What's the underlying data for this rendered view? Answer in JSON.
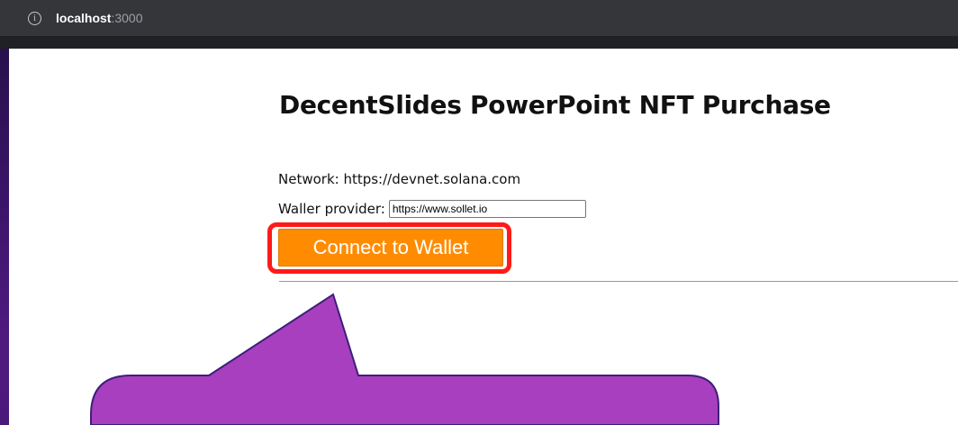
{
  "browser": {
    "url_host": "localhost",
    "url_port": ":3000",
    "info_icon": "info-icon"
  },
  "page": {
    "title": "DecentSlides PowerPoint NFT Purchase",
    "network_text": "Network: https://devnet.solana.com",
    "provider_label": "Waller provider:",
    "provider_value": "https://www.sollet.io",
    "connect_button_label": "Connect to Wallet"
  },
  "colors": {
    "button": "#ff8c00",
    "highlight": "#ff1a1a",
    "callout": "#a83fbf"
  }
}
